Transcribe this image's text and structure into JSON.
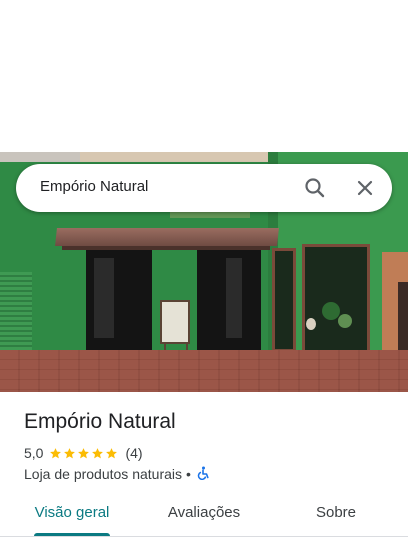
{
  "search": {
    "query": "Empório Natural",
    "search_icon": "search-icon",
    "close_icon": "close-icon"
  },
  "photo": {
    "description_icon": "storefront-photo"
  },
  "place": {
    "name": "Empório Natural",
    "rating": "5,0",
    "stars": 5,
    "reviews_count": "(4)",
    "category": "Loja de produtos naturais",
    "separator": "•",
    "accessibility_icon": "wheelchair-icon"
  },
  "tabs": [
    {
      "label": "Visão geral",
      "active": true
    },
    {
      "label": "Avaliações",
      "active": false
    },
    {
      "label": "Sobre",
      "active": false
    }
  ],
  "colors": {
    "accent": "#0b7a82",
    "star": "#fbbc04",
    "accessibility": "#1a73e8"
  }
}
